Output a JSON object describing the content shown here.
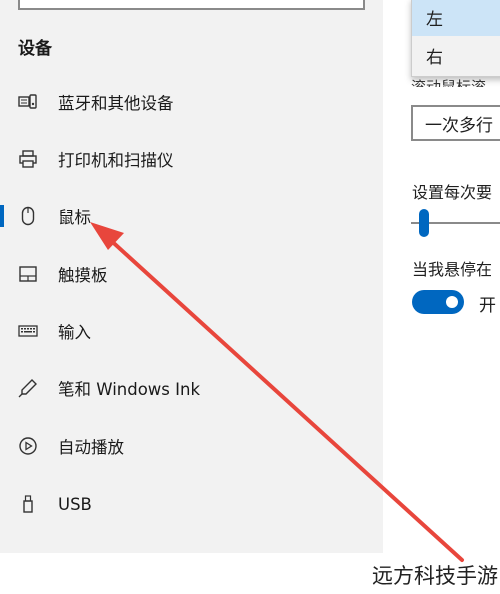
{
  "sidebar": {
    "section_title": "设备",
    "items": [
      {
        "label": "蓝牙和其他设备",
        "icon": "bluetooth-devices-icon",
        "active": false
      },
      {
        "label": "打印机和扫描仪",
        "icon": "printer-icon",
        "active": false
      },
      {
        "label": "鼠标",
        "icon": "mouse-icon",
        "active": true
      },
      {
        "label": "触摸板",
        "icon": "touchpad-icon",
        "active": false
      },
      {
        "label": "输入",
        "icon": "keyboard-icon",
        "active": false
      },
      {
        "label": "笔和 Windows Ink",
        "icon": "pen-icon",
        "active": false
      },
      {
        "label": "自动播放",
        "icon": "autoplay-icon",
        "active": false
      },
      {
        "label": "USB",
        "icon": "usb-icon",
        "active": false
      }
    ]
  },
  "main": {
    "dropdown_options": [
      {
        "label": "左",
        "selected": true
      },
      {
        "label": "右",
        "selected": false
      }
    ],
    "scroll_label": "滚动鼠标滚",
    "scroll_select_value": "一次多行",
    "lines_label": "设置每次要",
    "hover_label": "当我悬停在",
    "toggle_state": "开",
    "toggle_on": true
  },
  "annotation": {
    "arrow_color": "#e8463c"
  },
  "watermark": "远方科技手游"
}
